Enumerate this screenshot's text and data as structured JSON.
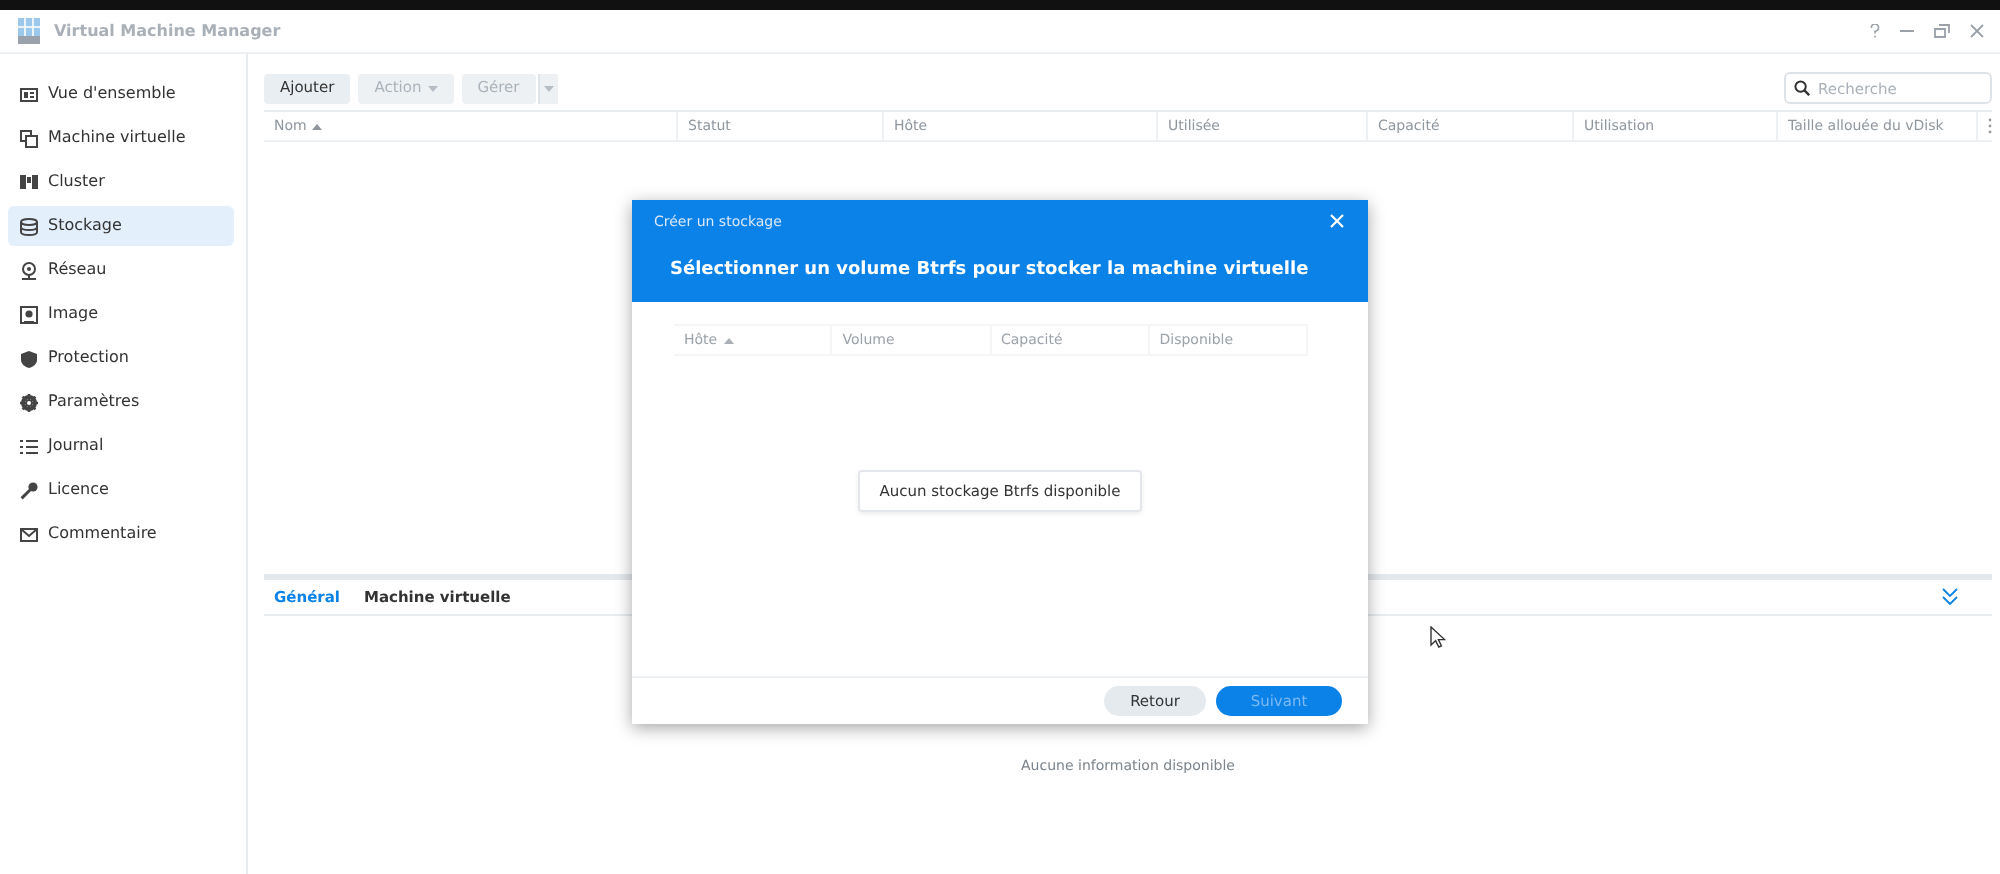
{
  "window": {
    "title": "Virtual Machine Manager"
  },
  "sidebar": {
    "items": [
      {
        "label": "Vue d'ensemble",
        "selected": false
      },
      {
        "label": "Machine virtuelle",
        "selected": false
      },
      {
        "label": "Cluster",
        "selected": false
      },
      {
        "label": "Stockage",
        "selected": true
      },
      {
        "label": "Réseau",
        "selected": false
      },
      {
        "label": "Image",
        "selected": false
      },
      {
        "label": "Protection",
        "selected": false
      },
      {
        "label": "Paramètres",
        "selected": false
      },
      {
        "label": "Journal",
        "selected": false
      },
      {
        "label": "Licence",
        "selected": false
      },
      {
        "label": "Commentaire",
        "selected": false
      }
    ]
  },
  "toolbar": {
    "buttons": [
      {
        "label": "Ajouter",
        "disabled": false,
        "dropdown": false
      },
      {
        "label": "Action",
        "disabled": true,
        "dropdown": true
      },
      {
        "label": "Gérer",
        "disabled": true,
        "split": true
      }
    ],
    "search": {
      "placeholder": "Recherche"
    }
  },
  "table": {
    "columns": [
      {
        "label": "Nom",
        "sorted": true
      },
      {
        "label": "Statut",
        "sorted": false
      },
      {
        "label": "Hôte",
        "sorted": false
      },
      {
        "label": "Utilisée",
        "sorted": false
      },
      {
        "label": "Capacité",
        "sorted": false
      },
      {
        "label": "Utilisation",
        "sorted": false
      },
      {
        "label": "Taille allouée du vDisk",
        "sorted": false
      }
    ]
  },
  "details": {
    "tabs": [
      {
        "label": "Général",
        "selected": true
      },
      {
        "label": "Machine virtuelle",
        "selected": false
      }
    ],
    "empty_text": "Aucune information disponible"
  },
  "dialog": {
    "title": "Créer un stockage",
    "heading": "Sélectionner un volume Btrfs pour stocker la machine virtuelle",
    "columns": [
      {
        "label": "Hôte",
        "sorted": true
      },
      {
        "label": "Volume",
        "sorted": false
      },
      {
        "label": "Capacité",
        "sorted": false
      },
      {
        "label": "Disponible",
        "sorted": false
      }
    ],
    "empty_text": "Aucun stockage Btrfs disponible",
    "buttons": [
      {
        "label": "Retour",
        "kind": "secondary",
        "disabled": false
      },
      {
        "label": "Suivant",
        "kind": "primary",
        "disabled": true
      }
    ]
  }
}
